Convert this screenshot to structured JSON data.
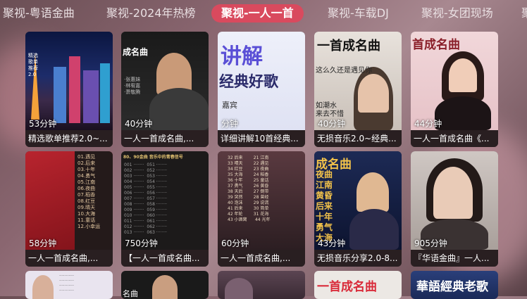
{
  "tabs": [
    "聚视-粤语金曲",
    "聚视-2024年热榜",
    "聚视-一人一首",
    "聚视-车载DJ",
    "聚视-女团现场",
    "聚"
  ],
  "active_tab": "聚视-一人一首",
  "row1": [
    {
      "duration": "53分钟",
      "title": "精选歌单推荐2.0~..."
    },
    {
      "duration": "40分钟",
      "title": "一人一首成名曲,..."
    },
    {
      "duration": "分钟",
      "title": "详细讲解10首经典..."
    },
    {
      "duration": "40分钟",
      "title": "无损音乐2.0~经典..."
    },
    {
      "duration": "44分钟",
      "title": "一人一首成名曲《..."
    }
  ],
  "row2": [
    {
      "duration": "58分钟",
      "title": "一人一首成名曲,..."
    },
    {
      "duration": "750分钟",
      "title": "【一人一首成名曲..."
    },
    {
      "duration": "60分钟",
      "title": "一人一首成名曲,..."
    },
    {
      "duration": "43分钟",
      "title": "无损音乐分享2.0-8..."
    },
    {
      "duration": "905分钟",
      "title": "『华语金曲』一人..."
    }
  ],
  "overlays": {
    "c2_title": "成名曲",
    "c3_big1": "讲解",
    "c3_big2": "经典好歌",
    "c3_small": "嘉宾",
    "c4_top": "一首成名曲",
    "c4_line1": "这么久还是遇见你",
    "c4_line2": "如潮水",
    "c4_line3": "来去不惜",
    "c5_top": "首成名曲",
    "r2c4_top": "成名曲",
    "r2c4_songs": "夜曲\n江南\n黄昏\n后来\n十年\n勇气\n大海",
    "r2c2_header": "80、90金曲 音乐中的青春信号",
    "r3c2": "名曲",
    "r3c4": "一首成名曲",
    "r3c5": "華語經典老歌"
  },
  "colors": {
    "active_tab_bg": "#d94a5e"
  }
}
